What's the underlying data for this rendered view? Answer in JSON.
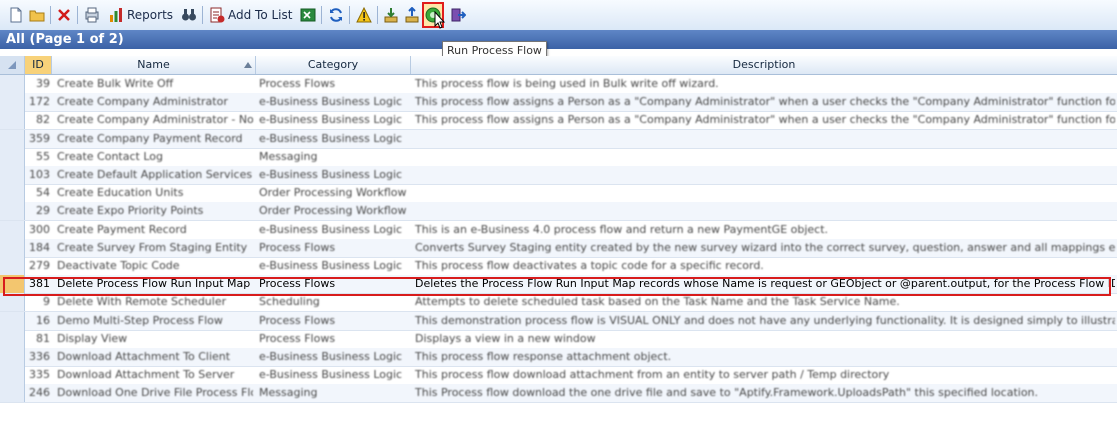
{
  "toolbar": {
    "reports_label": "Reports",
    "add_to_list_label": "Add To List",
    "tooltip": "Run Process Flow"
  },
  "title": "All (Page 1 of 2)",
  "columns": {
    "id": "ID",
    "name": "Name",
    "category": "Category",
    "description": "Description"
  },
  "rows": [
    {
      "id": "39",
      "name": "Create Bulk Write Off",
      "category": "Process Flows",
      "description": "This process flow is being used in Bulk write off wizard."
    },
    {
      "id": "172",
      "name": "Create Company Administrator",
      "category": "e-Business Business Logic",
      "description": "This process flow assigns a Person as a \"Company Administrator\" when a user checks the \"Company Administrator\" function for this person."
    },
    {
      "id": "82",
      "name": "Create Company Administrator - Not In Use",
      "category": "e-Business Business Logic",
      "description": "This process flow assigns a Person as a \"Company Administrator\" when a user checks the \"Company Administrator\" function for this person."
    },
    {
      "id": "359",
      "name": "Create Company Payment Record",
      "category": "e-Business Business Logic",
      "description": ""
    },
    {
      "id": "55",
      "name": "Create Contact Log",
      "category": "Messaging",
      "description": ""
    },
    {
      "id": "103",
      "name": "Create Default Application Services",
      "category": "e-Business Business Logic",
      "description": ""
    },
    {
      "id": "54",
      "name": "Create Education Units",
      "category": "Order Processing Workflow",
      "description": ""
    },
    {
      "id": "29",
      "name": "Create Expo Priority Points",
      "category": "Order Processing Workflow",
      "description": ""
    },
    {
      "id": "300",
      "name": "Create Payment Record",
      "category": "e-Business Business Logic",
      "description": "This is an e-Business 4.0 process flow and return a new PaymentGE object."
    },
    {
      "id": "184",
      "name": "Create Survey From Staging Entity",
      "category": "Process Flows",
      "description": "Converts Survey Staging entity created by the new survey wizard into the correct survey, question, answer and all mappings entities."
    },
    {
      "id": "279",
      "name": "Deactivate Topic Code",
      "category": "e-Business Business Logic",
      "description": "This process flow deactivates a topic code for a specific record."
    },
    {
      "id": "381",
      "name": "Delete Process Flow Run Input Map",
      "category": "Process Flows",
      "description": "Deletes the Process Flow Run Input Map records whose Name is request or GEObject or @parent.output, for the Process Flow IDs provided."
    },
    {
      "id": "9",
      "name": "Delete With Remote Scheduler",
      "category": "Scheduling",
      "description": "Attempts to delete scheduled task based on the Task Name and the Task Service Name."
    },
    {
      "id": "16",
      "name": "Demo Multi-Step Process Flow",
      "category": "Process Flows",
      "description": "This demonstration process flow is VISUAL ONLY and does not have any underlying functionality. It is designed simply to illustrate the concept"
    },
    {
      "id": "81",
      "name": "Display View",
      "category": "Process Flows",
      "description": "Displays a view in a new window"
    },
    {
      "id": "336",
      "name": "Download Attachment To Client",
      "category": "e-Business Business Logic",
      "description": "This process flow response attachment object."
    },
    {
      "id": "335",
      "name": "Download Attachment To Server",
      "category": "e-Business Business Logic",
      "description": "This process flow download attachment from an entity to server path / Temp directory"
    },
    {
      "id": "246",
      "name": "Download One Drive File Process Flow",
      "category": "Messaging",
      "description": "This Process flow download the one drive file and save to \"Aptify.Framework.UploadsPath\" this specified location."
    }
  ]
}
